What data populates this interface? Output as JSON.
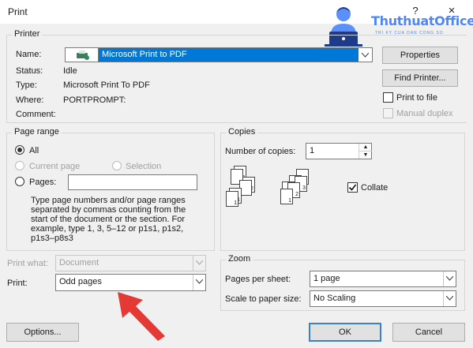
{
  "window": {
    "title": "Print",
    "help": "?",
    "close": "×"
  },
  "logo": {
    "name": "ThuthuatOffice",
    "tagline": "TRI KY CUA DAN CONG SO"
  },
  "printer": {
    "group_label": "Printer",
    "name_label": "Name:",
    "name_value": "Microsoft Print to PDF",
    "status_label": "Status:",
    "status_value": "Idle",
    "type_label": "Type:",
    "type_value": "Microsoft Print To PDF",
    "where_label": "Where:",
    "where_value": "PORTPROMPT:",
    "comment_label": "Comment:",
    "properties_button": "Properties",
    "find_printer_button": "Find Printer...",
    "print_to_file_label": "Print to file",
    "manual_duplex_label": "Manual duplex"
  },
  "page_range": {
    "group_label": "Page range",
    "all_label": "All",
    "current_page_label": "Current page",
    "selection_label": "Selection",
    "pages_label": "Pages:",
    "pages_value": "",
    "help_lines": [
      "Type page numbers and/or page ranges",
      "separated by commas counting from the",
      "start of the document or the section. For",
      "example, type 1, 3, 5–12 or p1s1, p1s2,",
      "p1s3–p8s3"
    ]
  },
  "copies": {
    "group_label": "Copies",
    "number_label": "Number of copies:",
    "number_value": "1",
    "collate_label": "Collate",
    "collate_checked": true,
    "page_numbers": [
      "1",
      "2",
      "3"
    ]
  },
  "print_what": {
    "label": "Print what:",
    "value": "Document"
  },
  "print": {
    "label": "Print:",
    "value": "Odd pages"
  },
  "zoom": {
    "group_label": "Zoom",
    "pages_per_sheet_label": "Pages per sheet:",
    "pages_per_sheet_value": "1 page",
    "scale_label": "Scale to paper size:",
    "scale_value": "No Scaling"
  },
  "buttons": {
    "options": "Options...",
    "ok": "OK",
    "cancel": "Cancel"
  },
  "colors": {
    "accent": "#0078d7",
    "annotation_arrow": "#e53935",
    "logo_blue": "#4f86f7"
  }
}
